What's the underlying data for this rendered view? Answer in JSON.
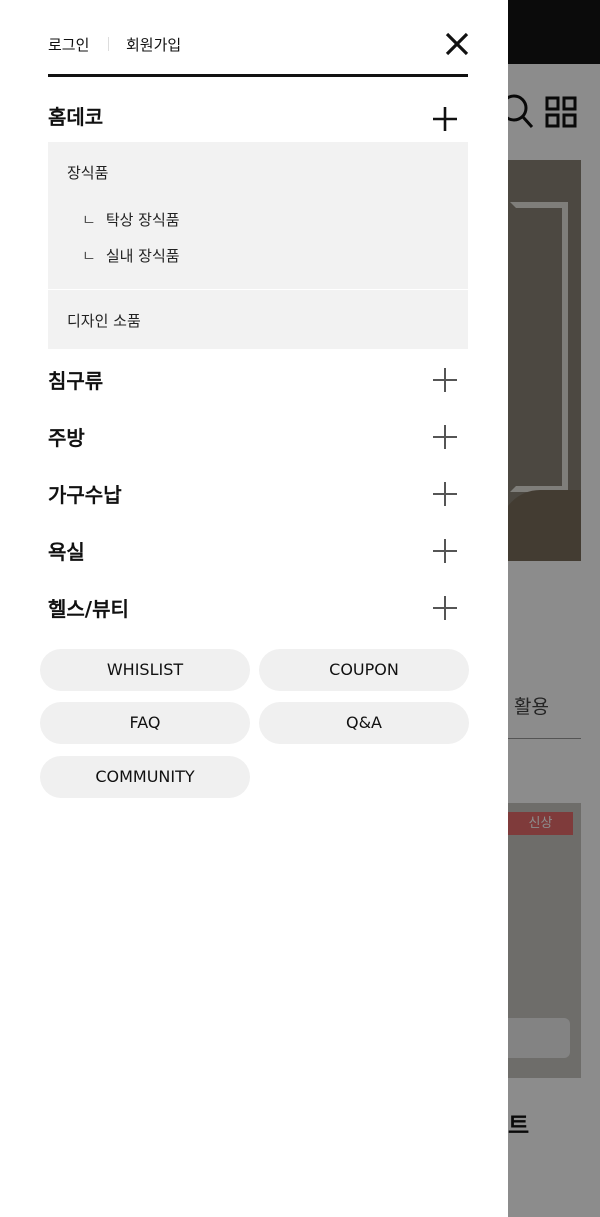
{
  "drawer": {
    "login": "로그인",
    "signup": "회원가입",
    "close_icon": "close-icon"
  },
  "categories": [
    {
      "label": "홈데코",
      "expanded": true,
      "subcategories": [
        {
          "label": "장식품",
          "children": [
            "탁상 장식품",
            "실내 장식품"
          ]
        },
        {
          "label": "디자인 소품",
          "children": []
        }
      ]
    },
    {
      "label": "침구류",
      "expanded": false
    },
    {
      "label": "주방",
      "expanded": false
    },
    {
      "label": "가구수납",
      "expanded": false
    },
    {
      "label": "욕실",
      "expanded": false
    },
    {
      "label": "헬스/뷰티",
      "expanded": false
    }
  ],
  "branch_glyph": "ㄴ",
  "quick_links": [
    "WHISLIST",
    "COUPON",
    "FAQ",
    "Q&A",
    "COMMUNITY"
  ],
  "background": {
    "tab_text": "활용",
    "badge": "신상",
    "product_title": "트"
  },
  "colors": {
    "overlay": "#000000",
    "badge": "#e86c6c",
    "pill_bg": "#f0f0f0",
    "submenu_bg": "#f2f2f2"
  }
}
